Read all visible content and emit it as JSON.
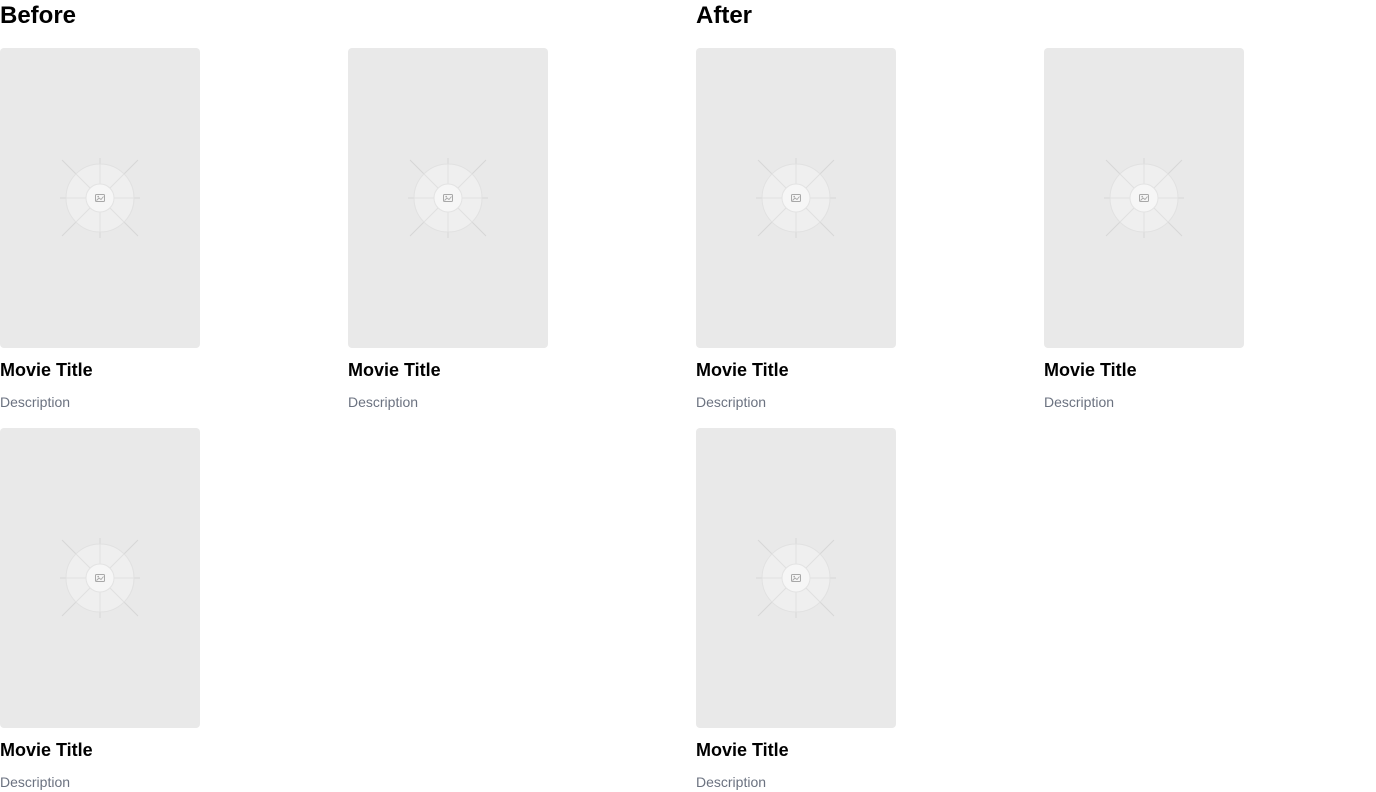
{
  "sections": [
    {
      "heading": "Before",
      "cards": [
        {
          "title": "Movie Title",
          "description": "Description",
          "poster_icon": "image-placeholder-icon"
        },
        {
          "title": "Movie Title",
          "description": "Description",
          "poster_icon": "image-placeholder-icon"
        },
        {
          "title": "Movie Title",
          "description": "Description",
          "poster_icon": "image-placeholder-icon"
        }
      ]
    },
    {
      "heading": "After",
      "cards": [
        {
          "title": "Movie Title",
          "description": "Description",
          "poster_icon": "image-placeholder-icon"
        },
        {
          "title": "Movie Title",
          "description": "Description",
          "poster_icon": "image-placeholder-icon"
        },
        {
          "title": "Movie Title",
          "description": "Description",
          "poster_icon": "image-placeholder-icon"
        }
      ]
    }
  ],
  "colors": {
    "poster_background": "#e9e9e9",
    "title_text": "#000000",
    "description_text": "#6b7280"
  }
}
